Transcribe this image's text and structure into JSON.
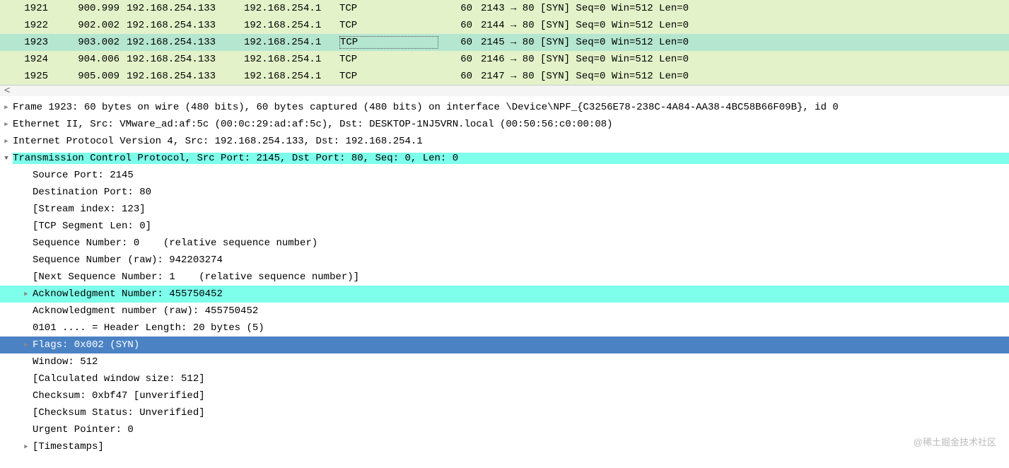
{
  "packet_list": {
    "rows": [
      {
        "no": "1921",
        "time": "900.999",
        "src": "192.168.254.133",
        "dst": "192.168.254.1",
        "protocol": "TCP",
        "len": "60",
        "info": "2143 → 80 [SYN] Seq=0 Win=512 Len=0",
        "selected": false
      },
      {
        "no": "1922",
        "time": "902.002",
        "src": "192.168.254.133",
        "dst": "192.168.254.1",
        "protocol": "TCP",
        "len": "60",
        "info": "2144 → 80 [SYN] Seq=0 Win=512 Len=0",
        "selected": false
      },
      {
        "no": "1923",
        "time": "903.002",
        "src": "192.168.254.133",
        "dst": "192.168.254.1",
        "protocol": "TCP",
        "len": "60",
        "info": "2145 → 80 [SYN] Seq=0 Win=512 Len=0",
        "selected": true
      },
      {
        "no": "1924",
        "time": "904.006",
        "src": "192.168.254.133",
        "dst": "192.168.254.1",
        "protocol": "TCP",
        "len": "60",
        "info": "2146 → 80 [SYN] Seq=0 Win=512 Len=0",
        "selected": false
      },
      {
        "no": "1925",
        "time": "905.009",
        "src": "192.168.254.133",
        "dst": "192.168.254.1",
        "protocol": "TCP",
        "len": "60",
        "info": "2147 → 80 [SYN] Seq=0 Win=512 Len=0",
        "selected": false
      }
    ]
  },
  "scroll_marker": "<",
  "details": {
    "frame": {
      "arrow": "right",
      "indent": 0,
      "text": "Frame 1923: 60 bytes on wire (480 bits), 60 bytes captured (480 bits) on interface \\Device\\NPF_{C3256E78-238C-4A84-AA38-4BC58B66F09B}, id 0",
      "hl": ""
    },
    "eth": {
      "arrow": "right",
      "indent": 0,
      "text": "Ethernet II, Src: VMware_ad:af:5c (00:0c:29:ad:af:5c), Dst: DESKTOP-1NJ5VRN.local (00:50:56:c0:00:08)",
      "hl": ""
    },
    "ip": {
      "arrow": "right",
      "indent": 0,
      "text": "Internet Protocol Version 4, Src: 192.168.254.133, Dst: 192.168.254.1",
      "hl": ""
    },
    "tcp": {
      "arrow": "down",
      "indent": 0,
      "text": "Transmission Control Protocol, Src Port: 2145, Dst Port: 80, Seq: 0, Len: 0",
      "hl": "cyan-field"
    },
    "srcport": {
      "arrow": "none",
      "indent": 1,
      "text": "Source Port: 2145",
      "hl": ""
    },
    "dstport": {
      "arrow": "none",
      "indent": 1,
      "text": "Destination Port: 80",
      "hl": ""
    },
    "stream": {
      "arrow": "none",
      "indent": 1,
      "text": "[Stream index: 123]",
      "hl": ""
    },
    "seglen": {
      "arrow": "none",
      "indent": 1,
      "text": "[TCP Segment Len: 0]",
      "hl": ""
    },
    "seqrel": {
      "arrow": "none",
      "indent": 1,
      "text": "Sequence Number: 0    (relative sequence number)",
      "hl": ""
    },
    "seqraw": {
      "arrow": "none",
      "indent": 1,
      "text": "Sequence Number (raw): 942203274",
      "hl": ""
    },
    "nextseq": {
      "arrow": "none",
      "indent": 1,
      "text": "[Next Sequence Number: 1    (relative sequence number)]",
      "hl": ""
    },
    "ack": {
      "arrow": "right",
      "indent": 1,
      "text": "Acknowledgment Number: 455750452",
      "hl": "cyan-row"
    },
    "ackraw": {
      "arrow": "none",
      "indent": 1,
      "text": "Acknowledgment number (raw): 455750452",
      "hl": ""
    },
    "hdrlen": {
      "arrow": "none",
      "indent": 1,
      "text": "0101 .... = Header Length: 20 bytes (5)",
      "hl": ""
    },
    "flags": {
      "arrow": "right",
      "indent": 1,
      "text": "Flags: 0x002 (SYN)",
      "hl": "blue-row"
    },
    "window": {
      "arrow": "none",
      "indent": 1,
      "text": "Window: 512",
      "hl": ""
    },
    "calcwin": {
      "arrow": "none",
      "indent": 1,
      "text": "[Calculated window size: 512]",
      "hl": ""
    },
    "cksum": {
      "arrow": "none",
      "indent": 1,
      "text": "Checksum: 0xbf47 [unverified]",
      "hl": ""
    },
    "cksumst": {
      "arrow": "none",
      "indent": 1,
      "text": "[Checksum Status: Unverified]",
      "hl": ""
    },
    "urgent": {
      "arrow": "none",
      "indent": 1,
      "text": "Urgent Pointer: 0",
      "hl": ""
    },
    "ts": {
      "arrow": "right",
      "indent": 1,
      "text": "[Timestamps]",
      "hl": ""
    }
  },
  "watermark": "@稀土掘金技术社区"
}
